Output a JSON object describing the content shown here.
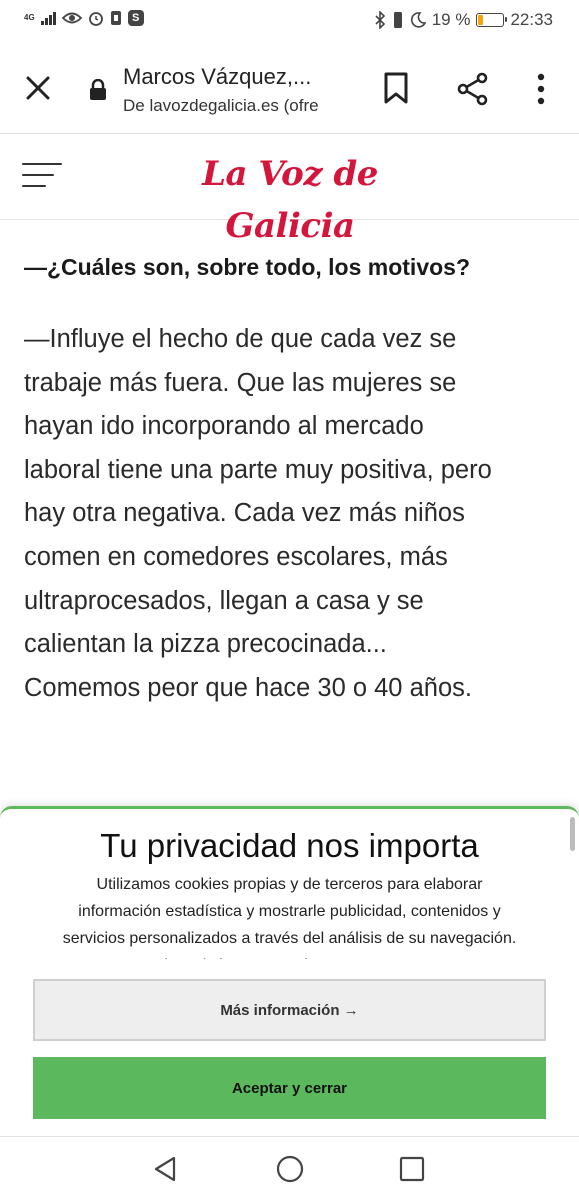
{
  "status_bar": {
    "network": "4G",
    "battery_percent": "19 %",
    "battery_level": 0.19,
    "time": "22:33",
    "app_badge": "S",
    "icons": [
      "signal-icon",
      "eye-icon",
      "alarm-icon",
      "sim-icon",
      "s-app-icon",
      "bluetooth-icon",
      "vibrate-icon",
      "moon-icon",
      "battery-icon"
    ]
  },
  "toolbar": {
    "title": "Marcos Vázquez,...",
    "url": "De lavozdegalicia.es (ofre",
    "icons": [
      "close-icon",
      "lock-icon",
      "bookmark-icon",
      "share-icon",
      "more-vert-icon"
    ]
  },
  "site": {
    "logo": "La Voz de Galicia",
    "brand_color": "#d4163c"
  },
  "article": {
    "question": "—¿Cuáles son, sobre todo, los motivos?",
    "answer_lines": [
      "—Influye el hecho de que cada vez se",
      "trabaje más fuera. Que las mujeres se",
      "hayan ido incorporando al mercado",
      "laboral tiene una parte muy positiva, pero",
      "hay otra negativa. Cada vez más niños",
      "comen en comedores escolares, más",
      "ultraprocesados, llegan a casa y se",
      "calientan la pizza precocinada...",
      "Comemos peor que hace 30 o 40 años."
    ]
  },
  "cookie_banner": {
    "title": "Tu privacidad nos importa",
    "text_lines": [
      "Utilizamos cookies propias y de terceros para elaborar",
      "información estadística y mostrarle publicidad, contenidos y",
      "servicios personalizados a través del análisis de su navegación.",
      "Si continúa navegando acepta su uso."
    ],
    "more_button": "Más información →",
    "accept_button": "Aceptar y cerrar",
    "accent_color": "#5cb85c"
  },
  "nav_bar": {
    "icons": [
      "back-icon",
      "home-icon",
      "recents-icon"
    ]
  }
}
